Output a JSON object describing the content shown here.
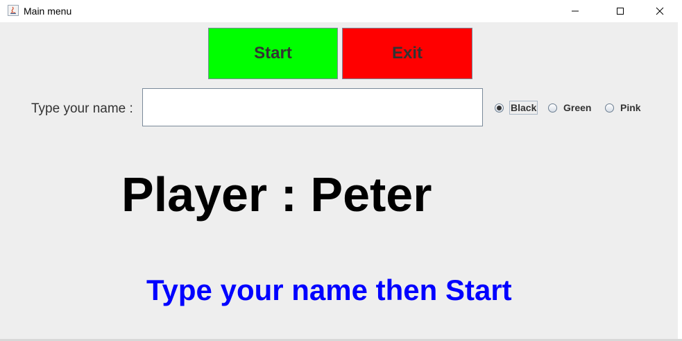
{
  "window": {
    "title": "Main menu",
    "app_icon": "java-icon",
    "controls": [
      "minimize-icon",
      "maximize-icon",
      "close-icon"
    ]
  },
  "buttons": {
    "start": {
      "label": "Start",
      "color": "#00ff00"
    },
    "exit": {
      "label": "Exit",
      "color": "#ff0000"
    }
  },
  "name_field": {
    "label": "Type your name :",
    "value": ""
  },
  "color_options": {
    "selected": "Black",
    "items": [
      {
        "label": "Black",
        "checked": true
      },
      {
        "label": "Green",
        "checked": false
      },
      {
        "label": "Pink",
        "checked": false
      }
    ]
  },
  "player": {
    "text": "Player : Peter",
    "color": "#000000"
  },
  "hint": {
    "text": "Type your name then Start",
    "color": "#0000ff"
  }
}
